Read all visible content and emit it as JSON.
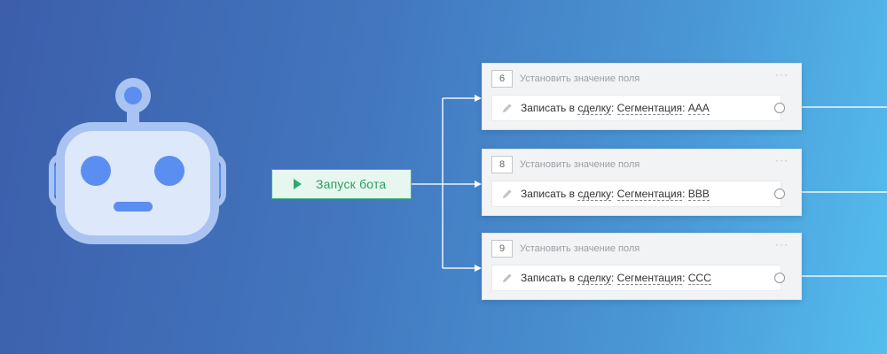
{
  "start_button": {
    "label": "Запуск бота"
  },
  "cards": [
    {
      "number": "6",
      "title": "Установить значение поля",
      "menu": "···",
      "action": {
        "prefix": "Записать в ",
        "entity": "сделку",
        "sep1": ": ",
        "field": "Сегментация",
        "sep2": ": ",
        "value": "AAA"
      }
    },
    {
      "number": "8",
      "title": "Установить значение поля",
      "menu": "···",
      "action": {
        "prefix": "Записать в ",
        "entity": "сделку",
        "sep1": ": ",
        "field": "Сегментация",
        "sep2": ": ",
        "value": "BBB"
      }
    },
    {
      "number": "9",
      "title": "Установить значение поля",
      "menu": "···",
      "action": {
        "prefix": "Записать в ",
        "entity": "сделку",
        "sep1": ": ",
        "field": "Сегментация",
        "sep2": ": ",
        "value": "CCC"
      }
    }
  ],
  "colors": {
    "background_start": "#3c5eab",
    "background_end": "#54bdee",
    "start_button_fill": "#e7f6ee",
    "start_button_accent": "#2eaa6d",
    "robot_face": "#dde8fb",
    "robot_frame": "#a9c3f2",
    "robot_eye": "#5b8ef1"
  },
  "icons": {
    "robot": "robot-illustration",
    "play": "play-icon",
    "pencil": "pencil-icon",
    "port": "connector-port-icon"
  }
}
